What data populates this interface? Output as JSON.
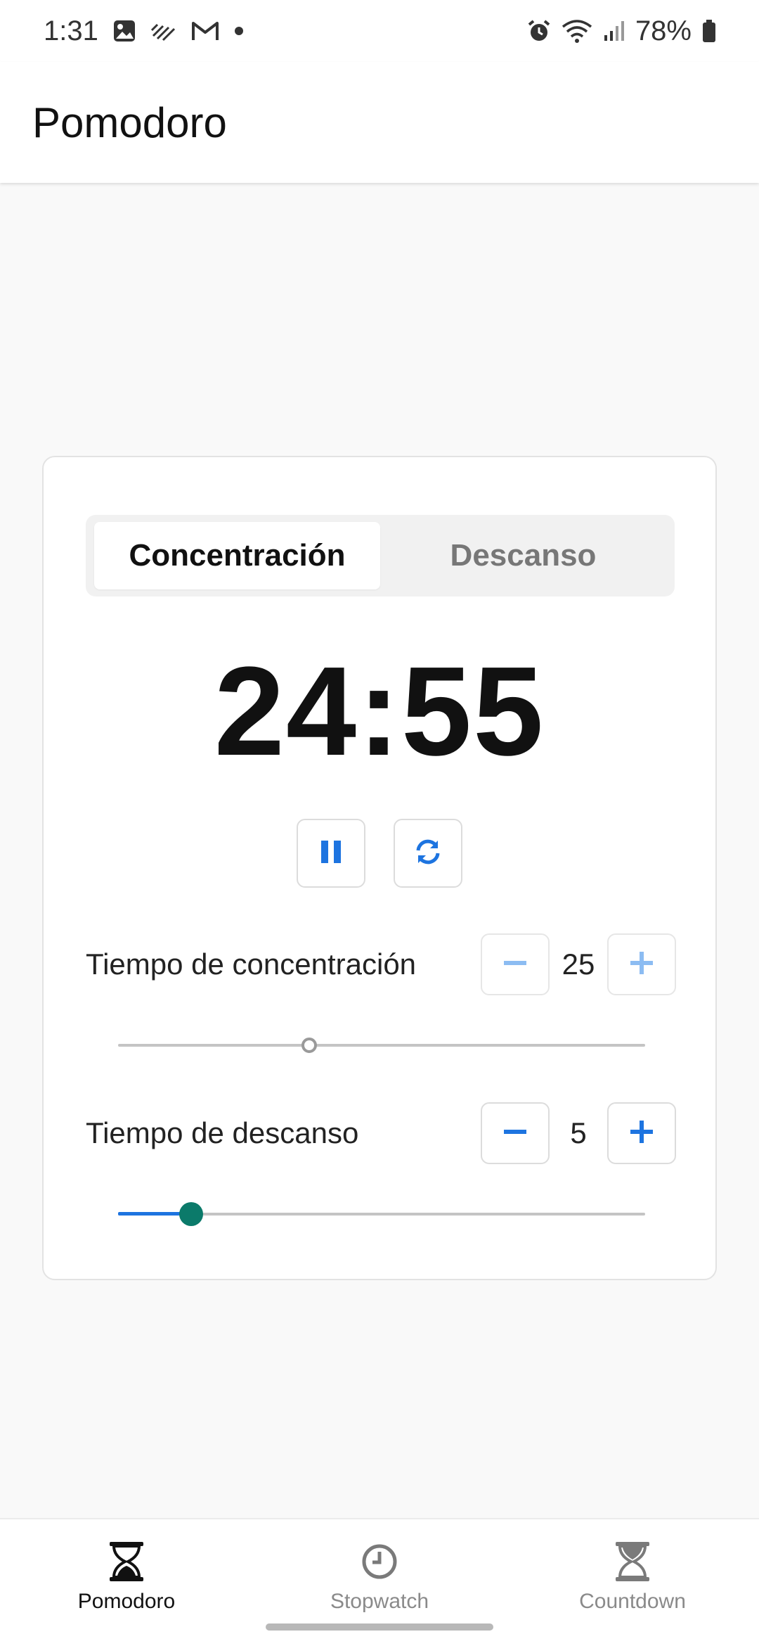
{
  "status_bar": {
    "time": "1:31",
    "battery": "78%",
    "left_icons": [
      "gallery-icon",
      "signal-noise-icon",
      "gmail-icon",
      "dot-icon"
    ],
    "right_icons": [
      "alarm-icon",
      "wifi-icon",
      "cell-signal-icon",
      "battery-icon"
    ]
  },
  "app_bar": {
    "title": "Pomodoro"
  },
  "mode_tabs": [
    {
      "label": "Concentración",
      "active": true
    },
    {
      "label": "Descanso",
      "active": false
    }
  ],
  "timer": {
    "display": "24:55"
  },
  "controls": {
    "pause_icon": "pause-icon",
    "reset_icon": "refresh-icon"
  },
  "focus_setting": {
    "label": "Tiempo de concentración",
    "value": "25",
    "slider_fraction": 0.36,
    "decrement_enabled": false,
    "increment_enabled": false
  },
  "break_setting": {
    "label": "Tiempo de descanso",
    "value": "5",
    "slider_fraction": 0.14,
    "decrement_enabled": true,
    "increment_enabled": true
  },
  "bottom_nav": [
    {
      "label": "Pomodoro",
      "icon": "hourglass-icon",
      "active": true
    },
    {
      "label": "Stopwatch",
      "icon": "clock-icon",
      "active": false
    },
    {
      "label": "Countdown",
      "icon": "hourglass-icon",
      "active": false
    }
  ],
  "colors": {
    "accent": "#1d74e0",
    "accent_disabled": "#8cbcf2",
    "thumb": "#0b7a6a"
  }
}
